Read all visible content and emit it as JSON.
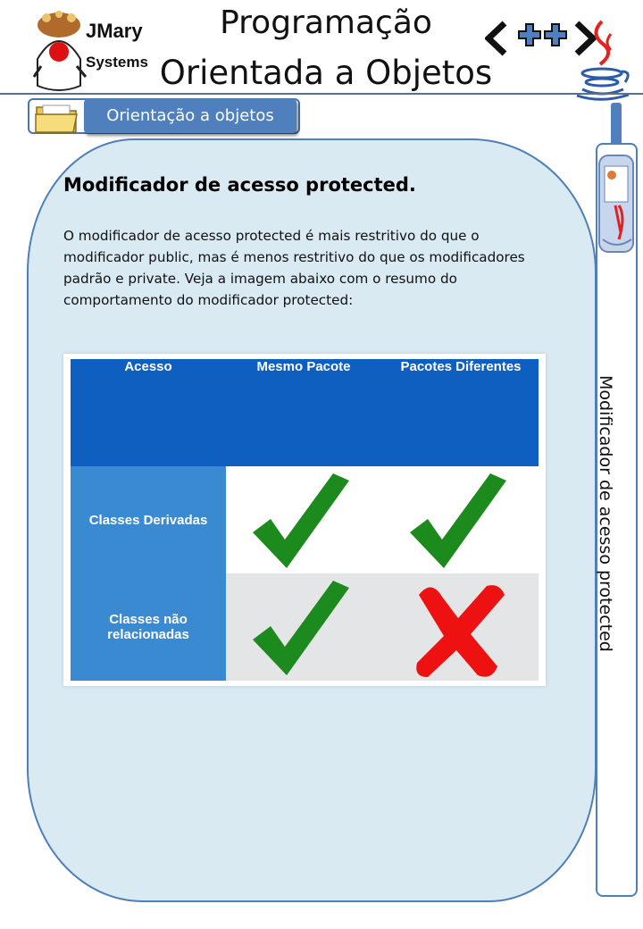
{
  "header": {
    "brand_line1": "JMary",
    "brand_line2": "Systems",
    "title_line1": "Programação",
    "title_line2": "Orientada a Objetos",
    "code_symbol": "<++>"
  },
  "breadcrumb": {
    "label": "Orientação a objetos",
    "icon": "folder-icon"
  },
  "content": {
    "heading": "Modificador de acesso protected.",
    "paragraph": "O modificador de acesso protected é mais restritivo do que o modificador public, mas é menos restritivo do que os modificadores padrão e private. Veja a imagem abaixo com o resumo do comportamento do modificador protected:"
  },
  "table": {
    "headers": [
      "Acesso",
      "Mesmo Pacote",
      "Pacotes Diferentes"
    ],
    "rows": [
      {
        "label": "Classes Derivadas",
        "same_package": "check",
        "different_packages": "check"
      },
      {
        "label": "Classes não relacionadas",
        "same_package": "check",
        "different_packages": "cross"
      }
    ],
    "colors": {
      "header": "#0f5fc1",
      "row_label": "#3a8ad1",
      "check": "#1c8a1c",
      "cross": "#ee1111"
    }
  },
  "sidebar": {
    "vertical_label": "Modificador de acesso protected",
    "icon": "newspaper-icon"
  }
}
